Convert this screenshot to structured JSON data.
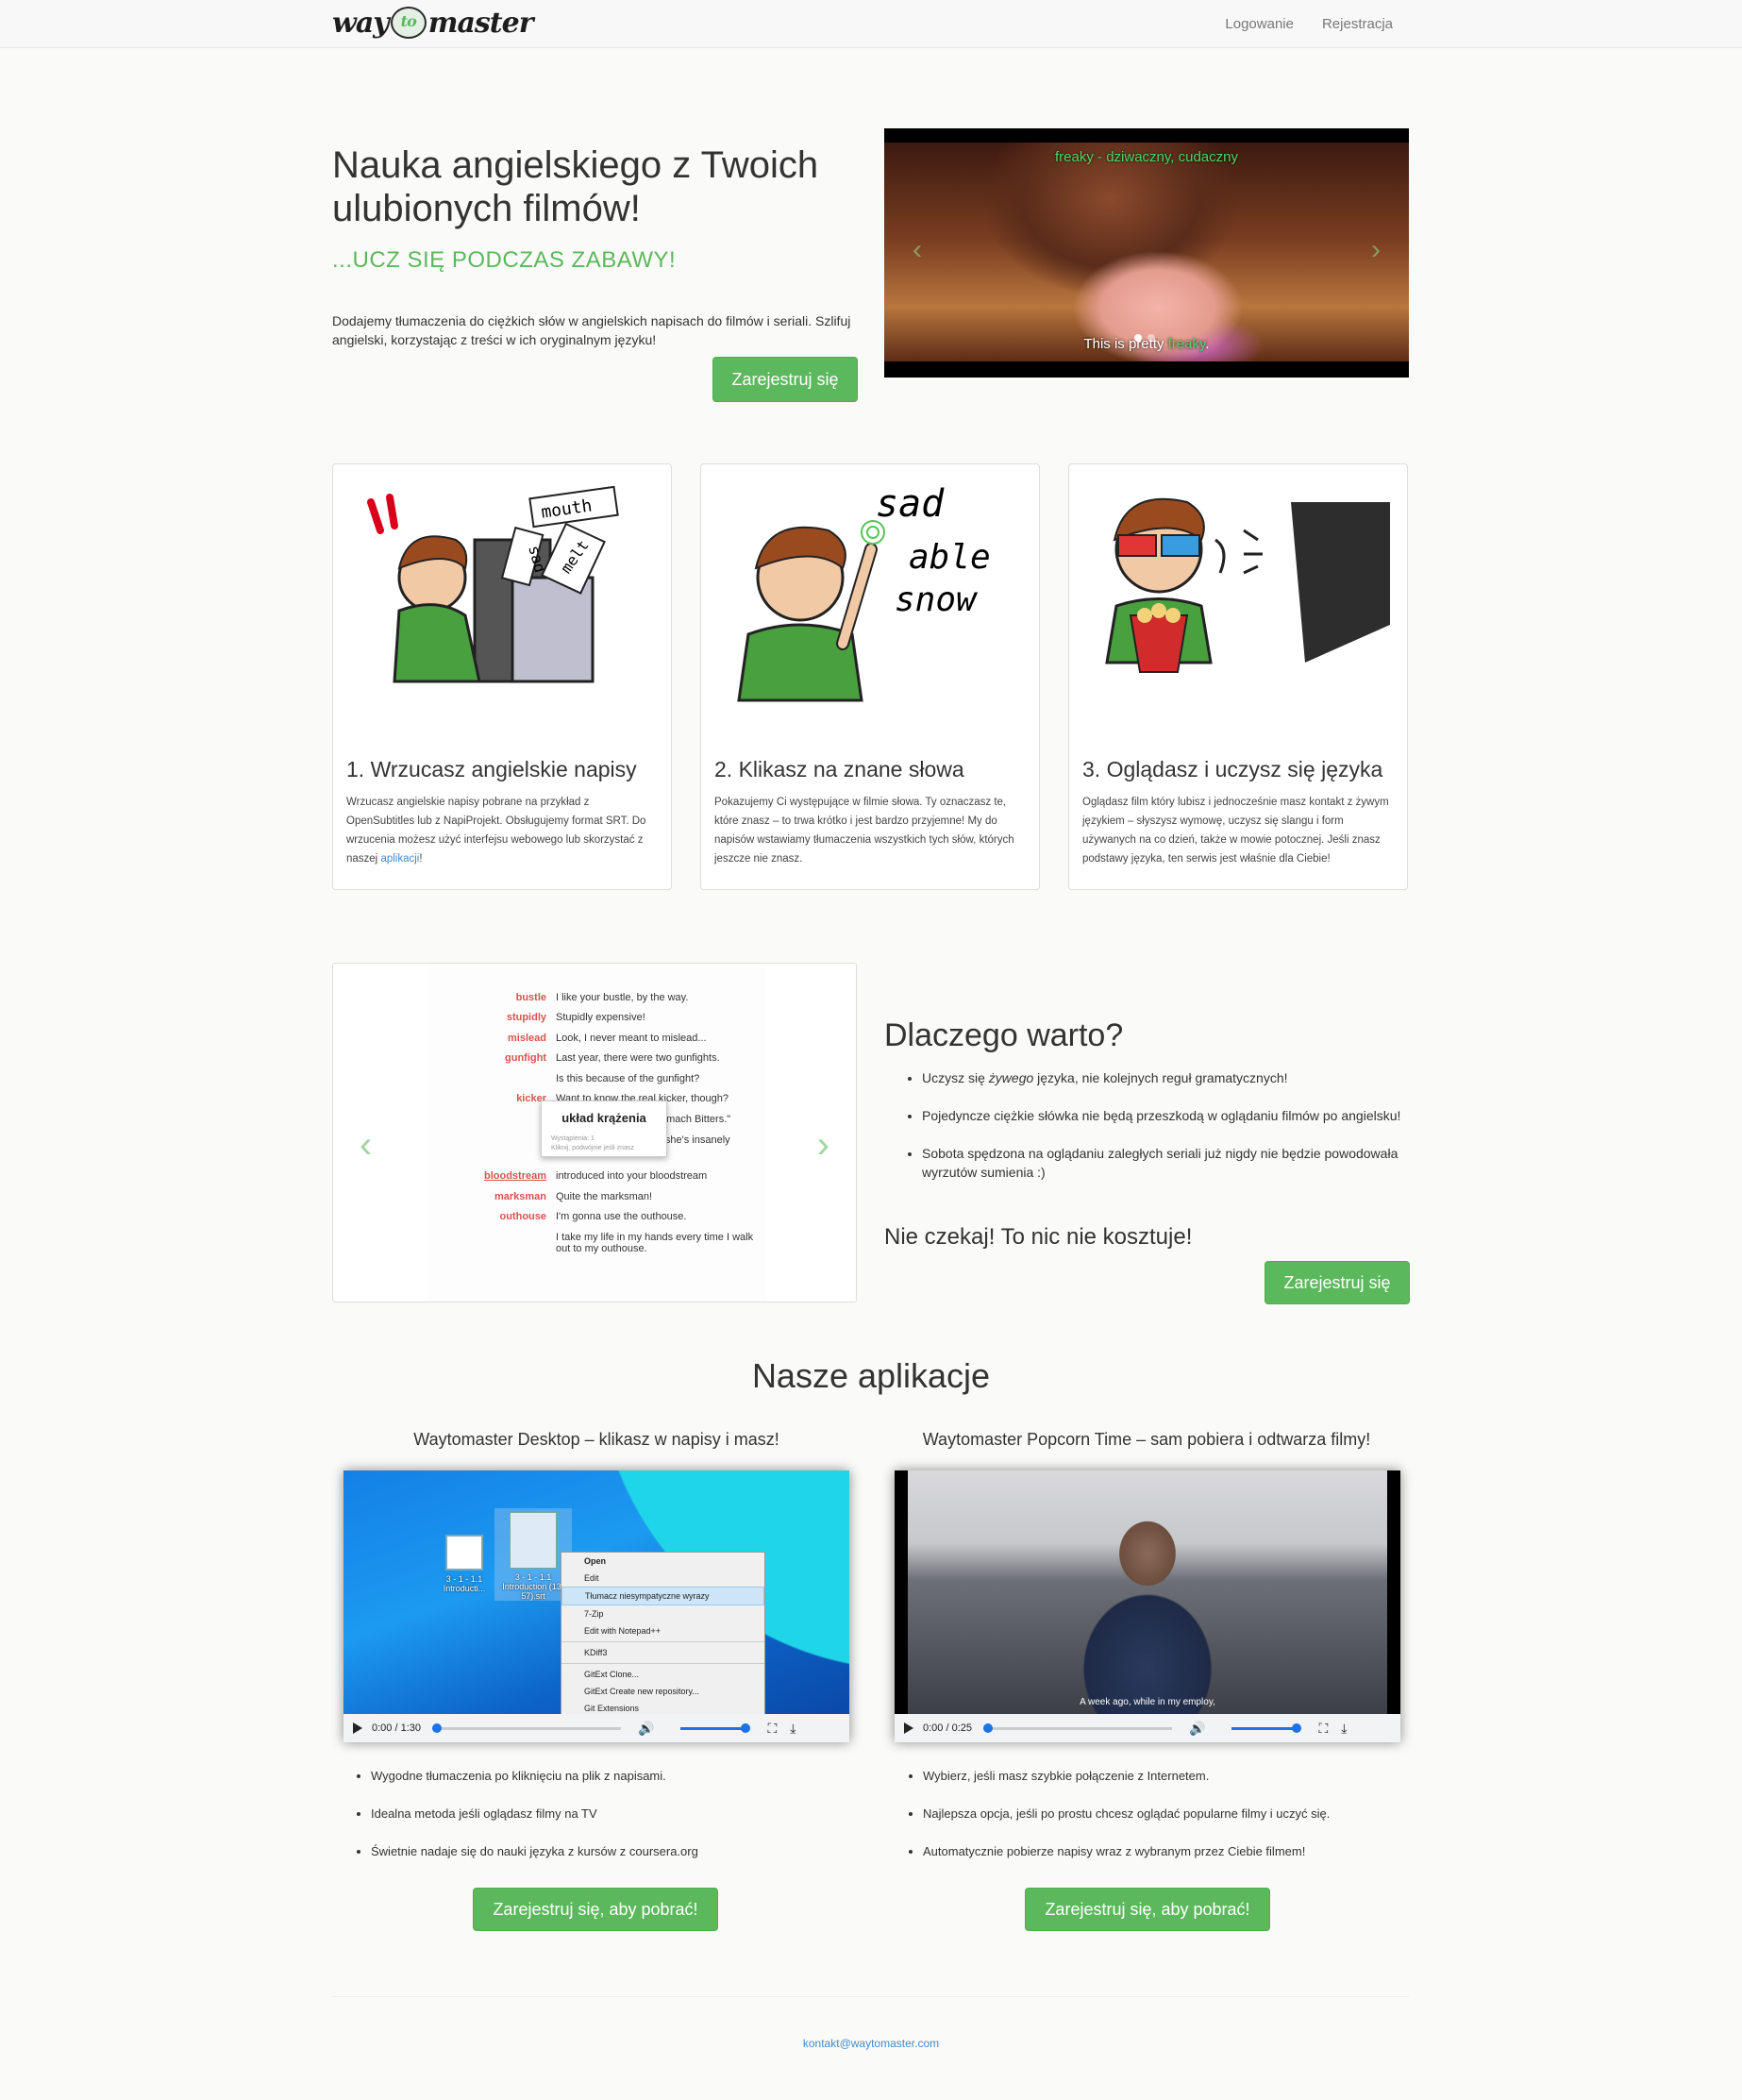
{
  "nav": {
    "logo": {
      "part1": "way",
      "part2": "to",
      "part3": "master"
    },
    "login": "Logowanie",
    "register": "Rejestracja"
  },
  "hero": {
    "title": "Nauka angielskiego z Twoich ulubionych filmów!",
    "subtitle": "...UCZ SIĘ PODCZAS ZABAWY!",
    "description": "Dodajemy tłumaczenia do ciężkich słów w angielskich napisach do filmów i seriali. Szlifuj angielski, korzystając z treści w ich oryginalnym języku!",
    "button": "Zarejestruj się",
    "video": {
      "subtitle_top": "freaky - dziwaczny, cudaczny",
      "subtitle_bottom_pre": "This is pretty ",
      "subtitle_bottom_hl": "freaky",
      "subtitle_bottom_post": "."
    }
  },
  "steps": [
    {
      "title": "1. Wrzucasz angielskie napisy",
      "text_pre": "Wrzucasz angielskie napisy pobrane na przykład z OpenSubtitles lub z NapiProjekt. Obsługujemy format SRT. Do wrzucenia możesz użyć interfejsu webowego lub skorzystać z naszej ",
      "link": "aplikacji",
      "text_post": "!",
      "illus_words": [
        "mouth",
        "sad",
        "melt"
      ]
    },
    {
      "title": "2. Klikasz na znane słowa",
      "text": "Pokazujemy Ci występujące w filmie słowa. Ty oznaczasz te, które znasz – to trwa krótko i jest bardzo przyjemne! My do napisów wstawiamy tłumaczenia wszystkich tych słów, których jeszcze nie znasz.",
      "illus_words": [
        "sad",
        "able",
        "snow"
      ]
    },
    {
      "title": "3. Oglądasz i uczysz się języka",
      "text": "Oglądasz film który lubisz i jednocześnie masz kontakt z żywym językiem – słyszysz wymowę, uczysz się slangu i form używanych na co dzień, także w mowie potocznej. Jeśli znasz podstawy języka, ten serwis jest właśnie dla Ciebie!"
    }
  ],
  "demo": {
    "rows": [
      {
        "word": "bustle",
        "sentence": "I like your bustle, by the way."
      },
      {
        "word": "stupidly",
        "sentence": "Stupidly expensive!"
      },
      {
        "word": "mislead",
        "sentence": "Look, I never meant to mislead..."
      },
      {
        "word": "gunfight",
        "sentence": "Last year, there were two gunfights."
      },
      {
        "word": "",
        "sentence": "Is this because of the gunfight?"
      },
      {
        "word": "kicker",
        "sentence": "Want to know the real kicker, though?"
      },
      {
        "word": "",
        "sentence": "Ogden's Celebrated Stomach Bitters.\""
      },
      {
        "word": "",
        "sentence": "She's classy, she's fun, she's insanely gorgeous."
      },
      {
        "word": "bloodstream",
        "sentence": "introduced into your bloodstream"
      },
      {
        "word": "marksman",
        "sentence": "Quite the marksman!"
      },
      {
        "word": "outhouse",
        "sentence": "I'm gonna use the outhouse."
      },
      {
        "word": "",
        "sentence": "I take my life in my hands every time I walk out to my outhouse."
      }
    ],
    "popup": {
      "title": "układ krążenia",
      "meta1": "Wystąpienia: 1",
      "meta2": "Kliknij, podwójnie jeśli znasz"
    },
    "prev": "‹",
    "next": "›"
  },
  "why": {
    "title": "Dlaczego warto?",
    "items": [
      {
        "pre": "Uczysz się ",
        "em": "żywego",
        "post": " języka, nie kolejnych reguł gramatycznych!"
      },
      {
        "text": "Pojedyncze ciężkie słówka nie będą przeszkodą w oglądaniu filmów po angielsku!"
      },
      {
        "text": "Sobota spędzona na oglądaniu zaległych seriali już nigdy nie będzie powodowała wyrzutów sumienia :)"
      }
    ],
    "cta": "Nie czekaj! To nic nie kosztuje!",
    "button": "Zarejestruj się"
  },
  "apps": {
    "title": "Nasze aplikacje",
    "desktop": {
      "title": "Waytomaster Desktop – klikasz w napisy i masz!",
      "time": "0:00 / 1:30",
      "progress": 0,
      "icons": [
        {
          "label": "3 - 1 - 1.1 Introducti..."
        },
        {
          "label": "3 - 1 - 1.1 Introduction (13-57).srt"
        }
      ],
      "menu": [
        "Open",
        "Edit",
        "Tłumacz niesympatyczne wyrazy",
        "7-Zip",
        "Edit with Notepad++",
        "KDiff3",
        "GitExt Clone...",
        "GitExt Create new repository...",
        "Git Extensions"
      ],
      "items": [
        "Wygodne tłumaczenia po kliknięciu na plik z napisami.",
        "Idealna metoda jeśli oglądasz filmy na TV",
        "Świetnie nadaje się do nauki języka z kursów z coursera.org"
      ],
      "button": "Zarejestruj się, aby pobrać!"
    },
    "popcorn": {
      "title": "Waytomaster Popcorn Time – sam pobiera i odtwarza filmy!",
      "time": "0:00 / 0:25",
      "progress": 0,
      "subtitle": "A week ago, while in my employ,",
      "items": [
        "Wybierz, jeśli masz szybkie połączenie z Internetem.",
        "Najlepsza opcja, jeśli po prostu chcesz oglądać popularne filmy i uczyć się.",
        "Automatycznie pobierze napisy wraz z wybranym przez Ciebie filmem!"
      ],
      "button": "Zarejestruj się, aby pobrać!"
    }
  },
  "footer": {
    "contact": "kontakt@waytomaster.com"
  },
  "colors": {
    "accent": "#5cb85c",
    "link": "#428bca",
    "word": "#d9534f"
  }
}
